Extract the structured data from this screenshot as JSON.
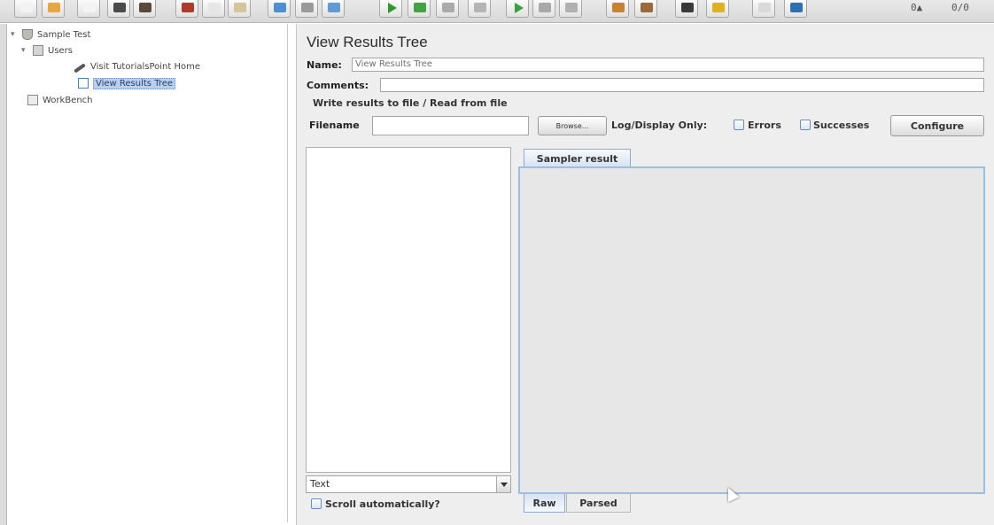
{
  "toolbar": {
    "buttons": [
      {
        "icon": "new-icon",
        "color": "#f3f3f3"
      },
      {
        "icon": "templates-icon",
        "color": "#e8a73a"
      },
      {
        "icon": "open-icon",
        "color": "#f4f4f4"
      },
      {
        "icon": "save-icon",
        "color": "#4a4a4a"
      },
      {
        "icon": "save-as-icon",
        "color": "#5b4a3a"
      },
      {
        "icon": "cut-icon",
        "color": "#b03a2e"
      },
      {
        "icon": "copy-icon",
        "color": "#e6e6e6"
      },
      {
        "icon": "paste-icon",
        "color": "#d6c49a"
      },
      {
        "icon": "expand-icon",
        "color": "#4d8fd6"
      },
      {
        "icon": "collapse-icon",
        "color": "#9a9a9a"
      },
      {
        "icon": "toggle-icon",
        "color": "#5d9ad8"
      },
      {
        "icon": "start-icon",
        "color": "#2e9a2e"
      },
      {
        "icon": "start-no-pause-icon",
        "color": "#43a343"
      },
      {
        "icon": "stop-icon",
        "color": "#aaaaaa"
      },
      {
        "icon": "shutdown-icon",
        "color": "#b5b5b5"
      },
      {
        "icon": "remote-start-icon",
        "color": "#3b9f3b"
      },
      {
        "icon": "remote-stop-icon",
        "color": "#a8a8a8"
      },
      {
        "icon": "remote-shutdown-icon",
        "color": "#b0b0b0"
      },
      {
        "icon": "clear-icon",
        "color": "#c9822f"
      },
      {
        "icon": "clear-all-icon",
        "color": "#9b6a3c"
      },
      {
        "icon": "search-icon",
        "color": "#3a3a3a"
      },
      {
        "icon": "reset-search-icon",
        "color": "#e0b020"
      },
      {
        "icon": "function-helper-icon",
        "color": "#d9d9d9"
      },
      {
        "icon": "help-icon",
        "color": "#2f6fb3"
      }
    ],
    "status_warning": "0▲",
    "status_threads": "0/0"
  },
  "tree": {
    "items": [
      {
        "label": "Sample Test",
        "icon": "test-plan-icon",
        "toggle": "▾"
      },
      {
        "label": "Users",
        "icon": "thread-group-icon",
        "toggle": "▾"
      },
      {
        "label": "Visit TutorialsPoint Home",
        "icon": "http-sampler-icon",
        "toggle": ""
      },
      {
        "label": "View Results Tree",
        "icon": "listener-icon",
        "toggle": ""
      },
      {
        "label": "WorkBench",
        "icon": "workbench-icon",
        "toggle": ""
      }
    ]
  },
  "panel": {
    "title": "View Results Tree",
    "name_label": "Name:",
    "name_value": "View Results Tree",
    "comments_label": "Comments:",
    "comments_value": "",
    "write_results_title": "Write results to file / Read from file",
    "filename_label": "Filename",
    "filename_value": "",
    "browse_label": "Browse...",
    "log_display_label": "Log/Display Only:",
    "errors_label": "Errors",
    "successes_label": "Successes",
    "configure_label": "Configure",
    "renderer_value": "Text",
    "scroll_label": "Scroll automatically?",
    "sampler_tab": "Sampler result",
    "raw_tab": "Raw",
    "parsed_tab": "Parsed"
  },
  "colors": {
    "selection": "#b8cff0",
    "tab_border": "#9fbde3",
    "panel_bg": "#eeeeee"
  }
}
